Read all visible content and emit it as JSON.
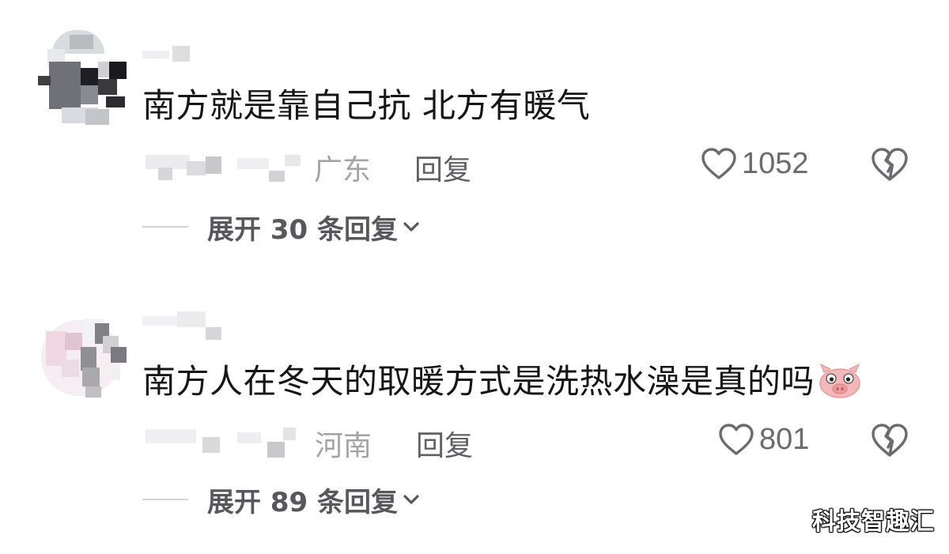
{
  "comments": [
    {
      "text": "南方就是靠自己抗 北方有暖气",
      "location": "广东",
      "reply_label": "回复",
      "likes": "1052",
      "expand_label": "展开 30 条回复"
    },
    {
      "text": "南方人在冬天的取暖方式是洗热水澡是真的吗",
      "emoji": "pig-face-emoji",
      "location": "河南",
      "reply_label": "回复",
      "likes": "801",
      "expand_label": "展开 89 条回复"
    }
  ],
  "icons": {
    "like": "heart-outline-icon",
    "dislike": "broken-heart-icon",
    "expand": "chevron-down-icon"
  },
  "colors": {
    "text": "#161616",
    "muted": "#a4a4a8",
    "action": "#5f5f64",
    "like_count": "#6b6b70"
  },
  "watermark": "科技智趣汇"
}
